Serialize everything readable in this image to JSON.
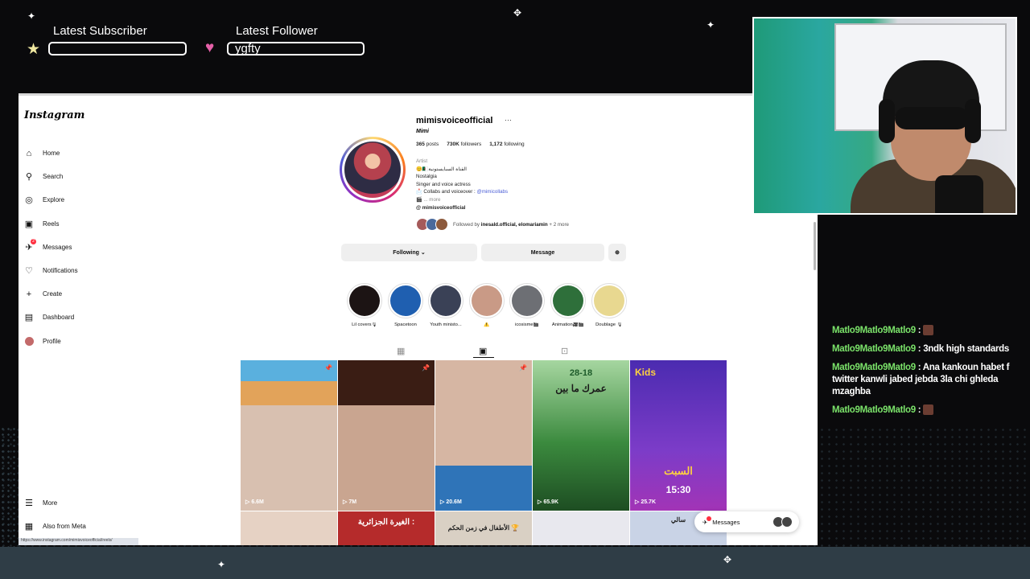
{
  "overlay": {
    "latest_subscriber_label": "Latest Subscriber",
    "latest_subscriber_value": "",
    "latest_follower_label": "Latest Follower",
    "latest_follower_value": "ygfty"
  },
  "sidebar": {
    "logo": "Instagram",
    "items": [
      {
        "label": "Home",
        "icon": "home-icon"
      },
      {
        "label": "Search",
        "icon": "search-icon"
      },
      {
        "label": "Explore",
        "icon": "compass-icon"
      },
      {
        "label": "Reels",
        "icon": "reels-icon"
      },
      {
        "label": "Messages",
        "icon": "messenger-icon",
        "badge": "2"
      },
      {
        "label": "Notifications",
        "icon": "heart-icon"
      },
      {
        "label": "Create",
        "icon": "plus-icon"
      },
      {
        "label": "Dashboard",
        "icon": "dashboard-icon"
      },
      {
        "label": "Profile",
        "icon": "avatar-icon"
      }
    ],
    "more_label": "More",
    "also_from_meta_label": "Also from Meta",
    "status_url": "https://www.instagram.com/mimisvoiceofficial/reels/"
  },
  "profile": {
    "username": "mimisvoiceofficial",
    "menu_glyph": "···",
    "full_name": "Mimi",
    "posts_count": "365",
    "posts_label": "posts",
    "followers_count": "730K",
    "followers_label": "followers",
    "following_count": "1,172",
    "following_label": "following",
    "bio": {
      "category": "Artist",
      "line1": "😊🇩🇿القناة السبايستونية",
      "line2": "Nostalgia",
      "line3": "Singer and voice actress",
      "line4_prefix": "📩 Collabs and voiceover : ",
      "line4_link": "@mimicollabs",
      "line5": "🎬 ... more",
      "threads_handle": "mimisvoiceofficial"
    },
    "followed_by_prefix": "Followed by",
    "followed_by_names": "inesald.official, elomariamin",
    "followed_by_suffix": "+ 2 more",
    "following_button": "Following ⌄",
    "message_button": "Message",
    "suggest_icon": "add-person-icon"
  },
  "highlights": [
    {
      "label": "Lil covers🎙",
      "color": "#1c1414"
    },
    {
      "label": "Spacetoon",
      "color": "#1f5fb0"
    },
    {
      "label": "Youth ministo...",
      "color": "#3a4156"
    },
    {
      "label": "⚠️",
      "color": "#c99a86"
    },
    {
      "label": "icosisme🎬",
      "color": "#6d6f74"
    },
    {
      "label": "Animation🎥🎬",
      "color": "#2e6f3a"
    },
    {
      "label": "Doublage 🎙",
      "color": "#e8d890"
    }
  ],
  "tabs": [
    {
      "icon": "grid-icon"
    },
    {
      "icon": "reels-tab-icon"
    },
    {
      "icon": "tagged-icon"
    }
  ],
  "reels": [
    {
      "views": "6.6M",
      "pinned": true
    },
    {
      "views": "7M",
      "pinned": true
    },
    {
      "views": "20.6M",
      "pinned": true
    },
    {
      "views": "65.9K",
      "pinned": false,
      "caption_top": "28-18",
      "caption_mid": "عمرك ما بين"
    },
    {
      "views": "25.7K",
      "pinned": false,
      "caption_top": "Kids",
      "caption_bottom": "السبت",
      "caption_time": "15:30"
    }
  ],
  "reels_row2_captions": [
    "الغيرة الجزائرية :",
    "الأطفال في زمن الحكم 🏆",
    "سالي"
  ],
  "floating_messages": {
    "label": "Messages",
    "badge": "3"
  },
  "chat": [
    {
      "user": "Matlo9Matlo9Matlo9",
      "text": ""
    },
    {
      "user": "Matlo9Matlo9Matlo9",
      "text": "3ndk high standards"
    },
    {
      "user": "Matlo9Matlo9Matlo9",
      "text": "Ana kankoun habet f twitter kanwli jabed jebda 3la chi ghleda mzaghba"
    },
    {
      "user": "Matlo9Matlo9Matlo9",
      "text": ""
    }
  ]
}
